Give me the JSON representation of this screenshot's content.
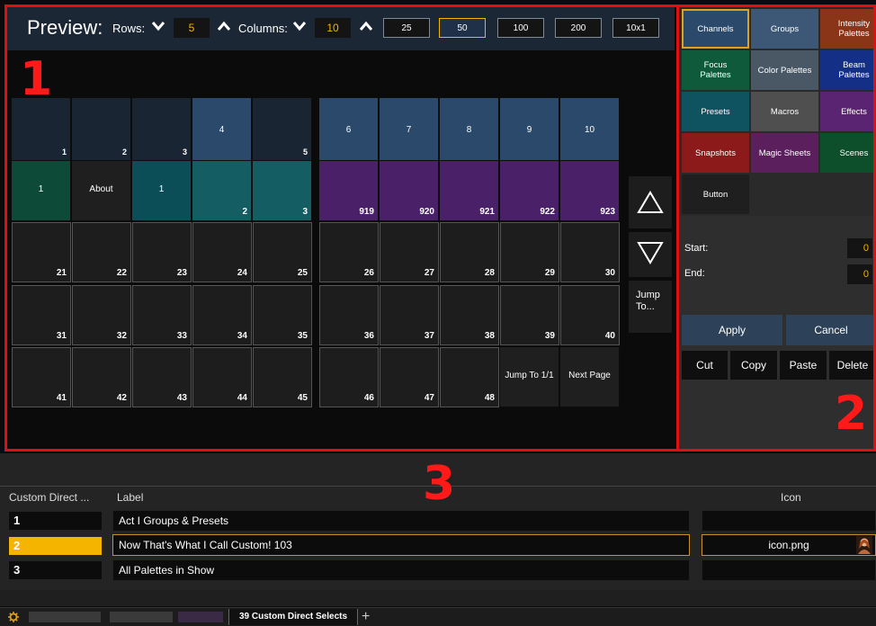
{
  "preview": {
    "title": "Preview:",
    "rows_label": "Rows:",
    "rows_value": "5",
    "columns_label": "Columns:",
    "columns_value": "10",
    "page_buttons": [
      "25",
      "50",
      "100",
      "200",
      "10x1"
    ],
    "selected_page_button": "50"
  },
  "annotations": {
    "one": "1",
    "two": "2",
    "three": "3"
  },
  "grid": {
    "left": [
      {
        "label": "",
        "num": "1"
      },
      {
        "label": "",
        "num": "2"
      },
      {
        "label": "",
        "num": "3"
      },
      {
        "label": "4",
        "num": ""
      },
      {
        "label": "",
        "num": "5"
      },
      {
        "label": "1",
        "num": ""
      },
      {
        "label": "About",
        "num": ""
      },
      {
        "label": "1",
        "num": ""
      },
      {
        "label": "",
        "num": "2"
      },
      {
        "label": "",
        "num": "3"
      },
      {
        "label": "",
        "num": "21"
      },
      {
        "label": "",
        "num": "22"
      },
      {
        "label": "",
        "num": "23"
      },
      {
        "label": "",
        "num": "24"
      },
      {
        "label": "",
        "num": "25"
      },
      {
        "label": "",
        "num": "31"
      },
      {
        "label": "",
        "num": "32"
      },
      {
        "label": "",
        "num": "33"
      },
      {
        "label": "",
        "num": "34"
      },
      {
        "label": "",
        "num": "35"
      },
      {
        "label": "",
        "num": "41"
      },
      {
        "label": "",
        "num": "42"
      },
      {
        "label": "",
        "num": "43"
      },
      {
        "label": "",
        "num": "44"
      },
      {
        "label": "",
        "num": "45"
      }
    ],
    "right": [
      {
        "label": "6",
        "num": ""
      },
      {
        "label": "7",
        "num": ""
      },
      {
        "label": "8",
        "num": ""
      },
      {
        "label": "9",
        "num": ""
      },
      {
        "label": "10",
        "num": ""
      },
      {
        "label": "",
        "num": "919"
      },
      {
        "label": "",
        "num": "920"
      },
      {
        "label": "",
        "num": "921"
      },
      {
        "label": "",
        "num": "922"
      },
      {
        "label": "",
        "num": "923"
      },
      {
        "label": "",
        "num": "26"
      },
      {
        "label": "",
        "num": "27"
      },
      {
        "label": "",
        "num": "28"
      },
      {
        "label": "",
        "num": "29"
      },
      {
        "label": "",
        "num": "30"
      },
      {
        "label": "",
        "num": "36"
      },
      {
        "label": "",
        "num": "37"
      },
      {
        "label": "",
        "num": "38"
      },
      {
        "label": "",
        "num": "39"
      },
      {
        "label": "",
        "num": "40"
      },
      {
        "label": "",
        "num": "46"
      },
      {
        "label": "",
        "num": "47"
      },
      {
        "label": "",
        "num": "48"
      },
      {
        "label": "Jump To 1/1",
        "num": ""
      },
      {
        "label": "Next Page",
        "num": ""
      }
    ],
    "jump_to": "Jump To..."
  },
  "panel": {
    "buttons": [
      {
        "label": "Channels",
        "color": "#2b4a6b"
      },
      {
        "label": "Groups",
        "color": "#3d5876"
      },
      {
        "label": "Intensity Palettes",
        "color": "#8a3418"
      },
      {
        "label": "Focus Palettes",
        "color": "#0e5a3a"
      },
      {
        "label": "Color Palettes",
        "color": "#4a5866"
      },
      {
        "label": "Beam Palettes",
        "color": "#142f86"
      },
      {
        "label": "Presets",
        "color": "#0f5360"
      },
      {
        "label": "Macros",
        "color": "#4f4f4f"
      },
      {
        "label": "Effects",
        "color": "#5a2473"
      },
      {
        "label": "Snapshots",
        "color": "#8c1a1a"
      },
      {
        "label": "Magic Sheets",
        "color": "#5a1f5c"
      },
      {
        "label": "Scenes",
        "color": "#0c4f2a"
      },
      {
        "label": "Button",
        "color": "#1f1f1f"
      }
    ],
    "start_label": "Start:",
    "start_value": "0",
    "end_label": "End:",
    "end_value": "0",
    "apply": "Apply",
    "cancel": "Cancel",
    "cut": "Cut",
    "copy": "Copy",
    "paste": "Paste",
    "delete": "Delete"
  },
  "table": {
    "col_index": "Custom Direct ...",
    "col_label": "Label",
    "col_icon": "Icon",
    "rows": [
      {
        "index": "1",
        "label": "Act I Groups & Presets",
        "icon": ""
      },
      {
        "index": "2",
        "label": "Now That's What I Call Custom! 103",
        "icon": "icon.png"
      },
      {
        "index": "3",
        "label": "All Palettes in Show",
        "icon": ""
      }
    ]
  },
  "tabs": {
    "active": "39 Custom Direct Selects",
    "add": "+"
  }
}
